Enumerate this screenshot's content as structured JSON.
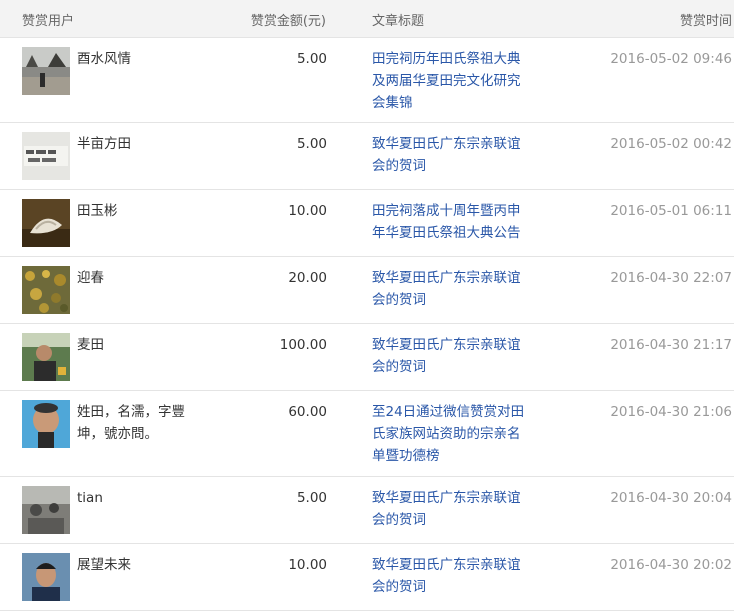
{
  "header": {
    "user": "赞赏用户",
    "amount": "赞赏金额(元)",
    "title": "文章标题",
    "time": "赞赏时间"
  },
  "rows": [
    {
      "user": "酉水风情",
      "amount": "5.00",
      "title": "田完祠历年田氏祭祖大典及两届华夏田完文化研究会集锦",
      "time": "2016-05-02 09:46"
    },
    {
      "user": "半亩方田",
      "amount": "5.00",
      "title": "致华夏田氏广东宗亲联谊会的贺词",
      "time": "2016-05-02 00:42"
    },
    {
      "user": "田玉彬",
      "amount": "10.00",
      "title": "田完祠落成十周年暨丙申年华夏田氏祭祖大典公告",
      "time": "2016-05-01 06:11"
    },
    {
      "user": "迎春",
      "amount": "20.00",
      "title": "致华夏田氏广东宗亲联谊会的贺词",
      "time": "2016-04-30 22:07"
    },
    {
      "user": "麦田",
      "amount": "100.00",
      "title": "致华夏田氏广东宗亲联谊会的贺词",
      "time": "2016-04-30 21:17"
    },
    {
      "user": "姓田，名濡，字豐坤，號亦問。",
      "amount": "60.00",
      "title": "至24日通过微信赞赏对田氏家族网站资助的宗亲名单暨功德榜",
      "time": "2016-04-30 21:06"
    },
    {
      "user": "tian",
      "amount": "5.00",
      "title": "致华夏田氏广东宗亲联谊会的贺词",
      "time": "2016-04-30 20:04"
    },
    {
      "user": "展望未来",
      "amount": "10.00",
      "title": "致华夏田氏广东宗亲联谊会的贺词",
      "time": "2016-04-30 20:02"
    }
  ],
  "colors": {
    "link": "#2a57a8",
    "time": "#999999",
    "header_bg": "#f3f3f3"
  }
}
